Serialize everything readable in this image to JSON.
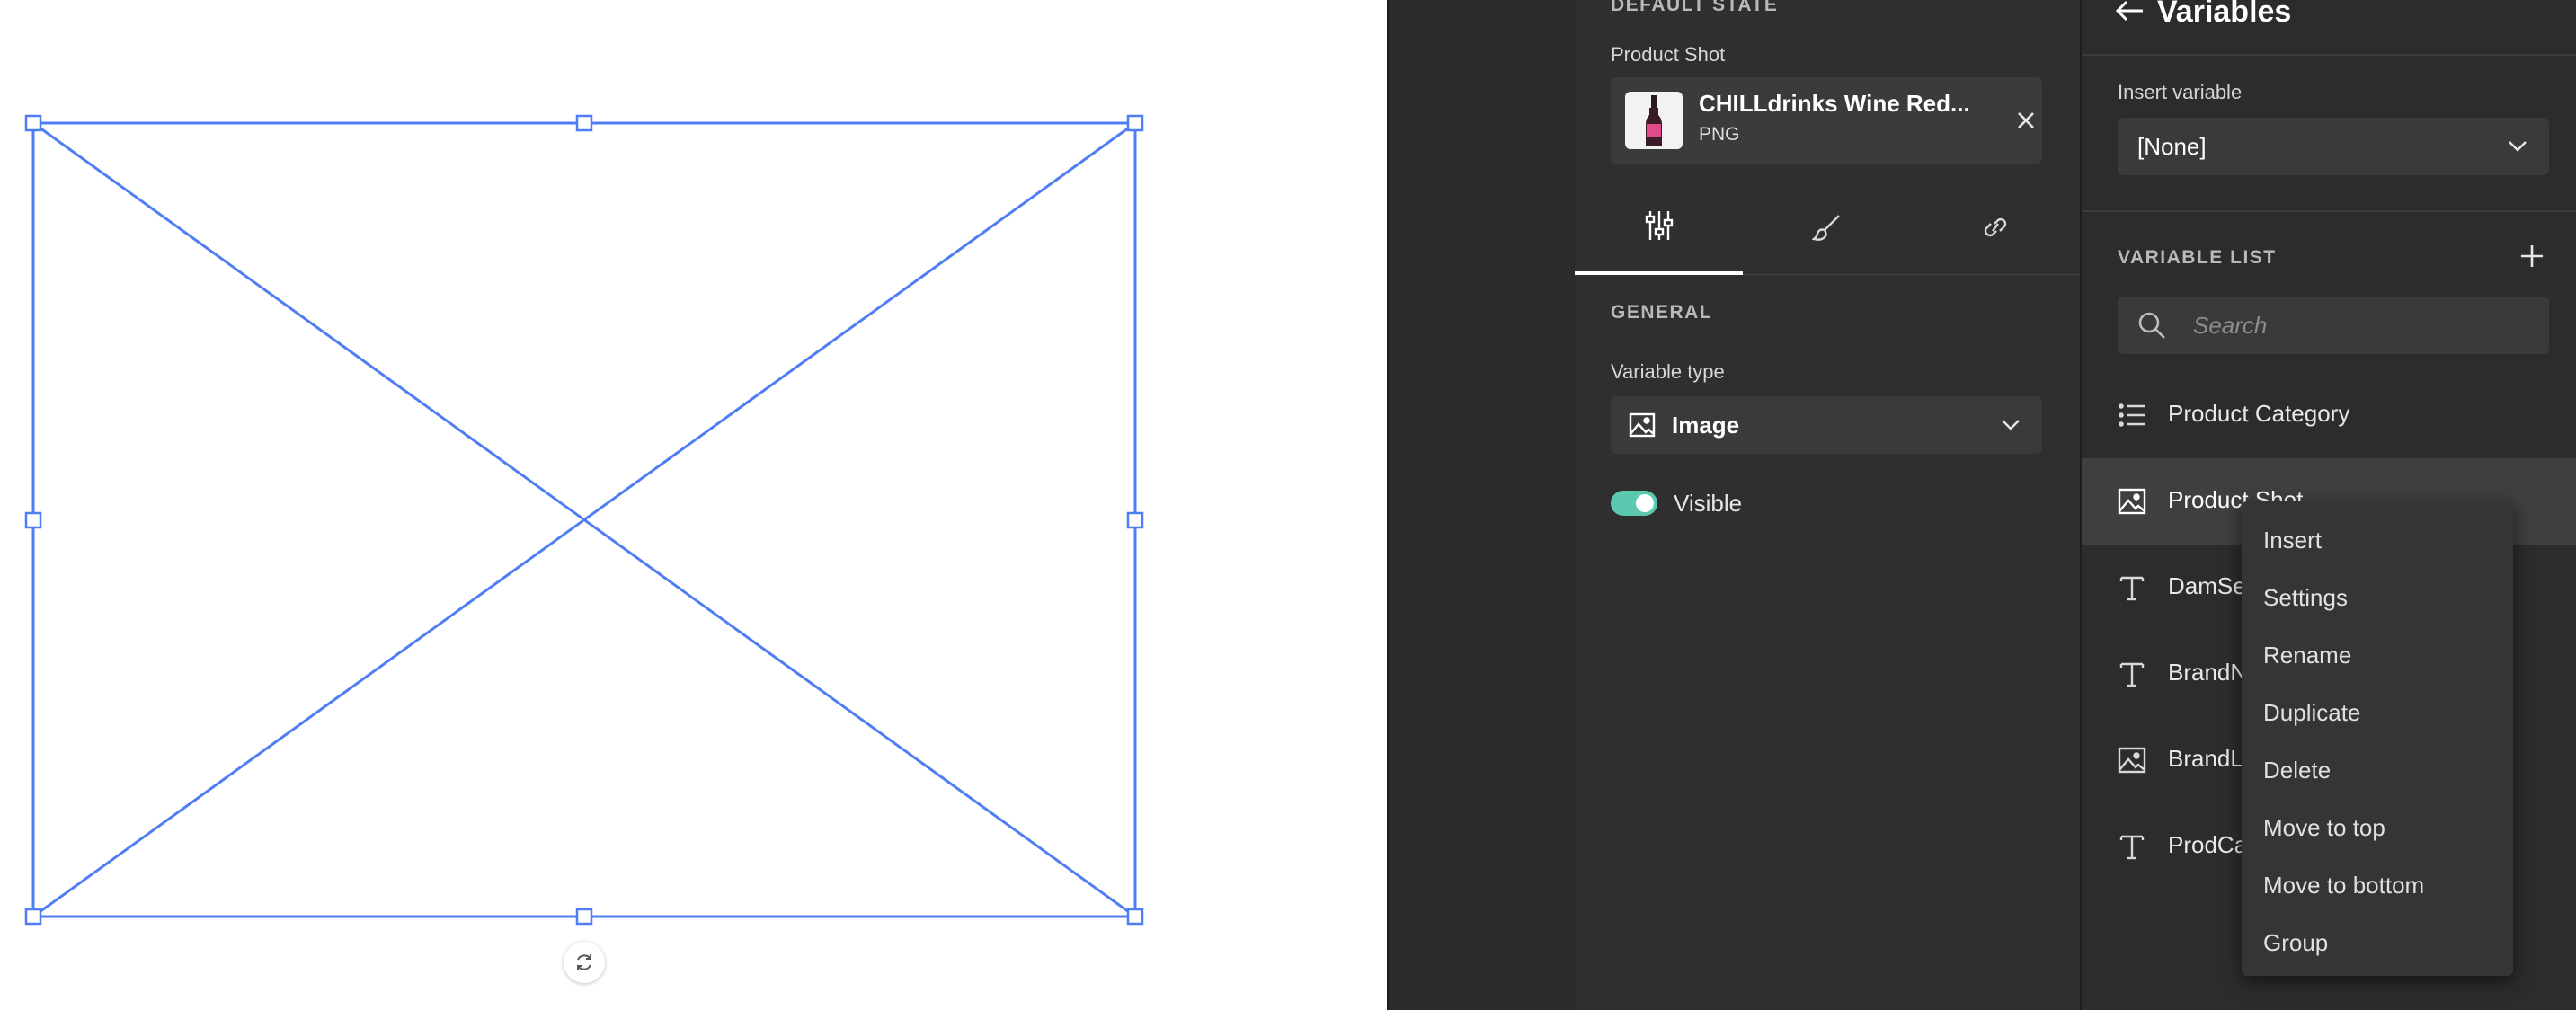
{
  "properties": {
    "default_state_heading": "DEFAULT STATE",
    "product_shot_label": "Product Shot",
    "file": {
      "name": "CHILLdrinks Wine Red...",
      "type": "PNG"
    },
    "tabs": [
      {
        "icon": "sliders-icon",
        "active": true
      },
      {
        "icon": "brush-icon",
        "active": false
      },
      {
        "icon": "link-icon",
        "active": false
      }
    ],
    "general_heading": "GENERAL",
    "variable_type_label": "Variable type",
    "variable_type_value": "Image",
    "visible_label": "Visible",
    "visible_on": true
  },
  "variables": {
    "title": "Variables",
    "insert_variable_label": "Insert variable",
    "insert_variable_value": "[None]",
    "list_heading": "VARIABLE LIST",
    "search_placeholder": "Search",
    "items": [
      {
        "label": "Product Category",
        "icon": "list-icon"
      },
      {
        "label": "Product Shot",
        "icon": "image-icon",
        "selected": true
      },
      {
        "label": "DamSe",
        "icon": "text-icon"
      },
      {
        "label": "BrandN",
        "icon": "text-icon"
      },
      {
        "label": "BrandL",
        "icon": "image-icon"
      },
      {
        "label": "ProdCa",
        "icon": "text-icon"
      }
    ]
  },
  "context_menu": {
    "items": [
      "Insert",
      "Settings",
      "Rename",
      "Duplicate",
      "Delete",
      "Move to top",
      "Move to bottom",
      "Group"
    ]
  },
  "colors": {
    "accent_blue": "#4f7df3",
    "toggle_on": "#5dc8b0"
  }
}
